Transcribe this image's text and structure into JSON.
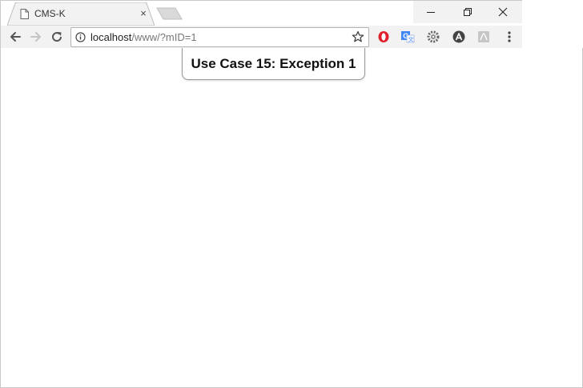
{
  "browser": {
    "tab": {
      "title": "CMS-K",
      "close_glyph": "×"
    },
    "window_controls": {
      "minimize_icon": "minimize-icon",
      "restore_icon": "restore-icon",
      "close_icon": "close-icon"
    },
    "toolbar": {
      "back_icon": "back-arrow-icon",
      "forward_icon": "forward-arrow-icon",
      "reload_icon": "reload-icon"
    },
    "omnibox": {
      "url_host": "localhost",
      "url_path": "/www/?mID=1"
    },
    "extensions": [
      {
        "name": "opera-icon",
        "color": "#e0202a"
      },
      {
        "name": "translate-icon",
        "color": "#4285f4"
      },
      {
        "name": "extension-gear-icon",
        "color": "#555555"
      },
      {
        "name": "arrow-a-icon",
        "color": "#444444"
      },
      {
        "name": "pdf-icon",
        "color": "#bbbbbb"
      },
      {
        "name": "menu-icon",
        "color": "#444444"
      }
    ]
  },
  "page": {
    "popup_title": "Use Case 15: Exception 1"
  }
}
